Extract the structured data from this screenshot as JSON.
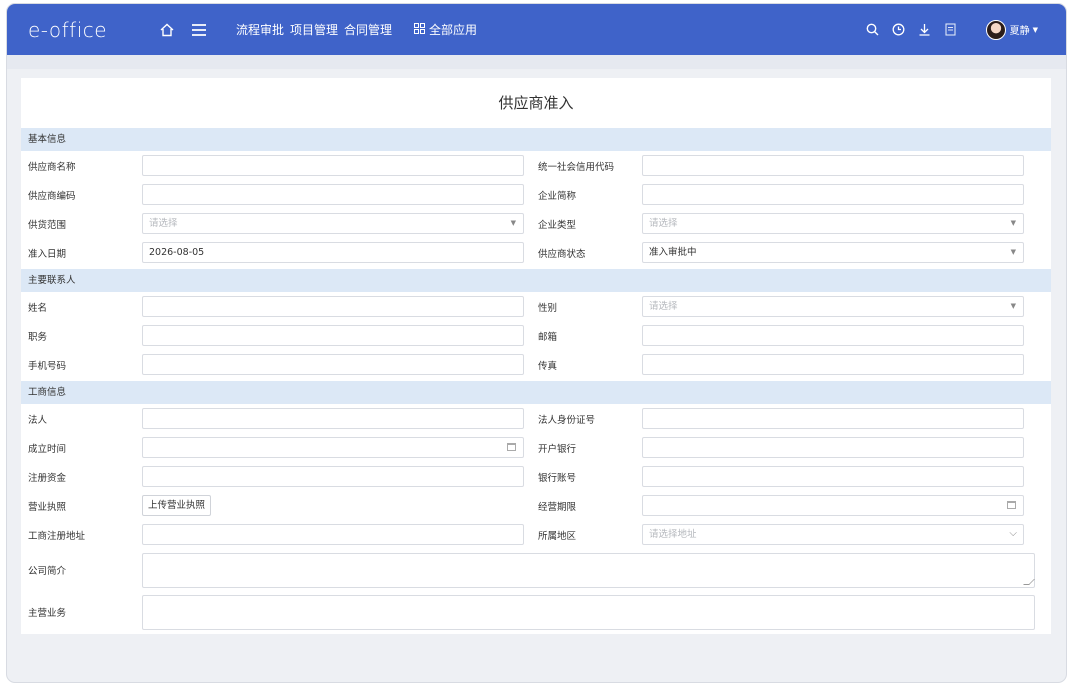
{
  "app": {
    "logo": "e-office"
  },
  "nav": {
    "links": [
      "流程审批",
      "项目管理",
      "合同管理"
    ],
    "all_apps": "全部应用"
  },
  "user": {
    "name": "夏静"
  },
  "form": {
    "title": "供应商准入",
    "sections": {
      "basic": "基本信息",
      "contact": "主要联系人",
      "business": "工商信息"
    },
    "fields": {
      "supplier_name": {
        "label": "供应商名称",
        "value": ""
      },
      "credit_code": {
        "label": "统一社会信用代码",
        "value": ""
      },
      "supplier_code": {
        "label": "供应商编码",
        "value": ""
      },
      "short_name": {
        "label": "企业简称",
        "value": ""
      },
      "supply_scope": {
        "label": "供货范围",
        "placeholder": "请选择"
      },
      "enterprise_type": {
        "label": "企业类型",
        "placeholder": "请选择"
      },
      "admit_date": {
        "label": "准入日期",
        "value": "2026-08-05"
      },
      "supplier_status": {
        "label": "供应商状态",
        "value": "准入审批中"
      },
      "name": {
        "label": "姓名",
        "value": ""
      },
      "gender": {
        "label": "性别",
        "placeholder": "请选择"
      },
      "position": {
        "label": "职务",
        "value": ""
      },
      "email": {
        "label": "邮箱",
        "value": ""
      },
      "mobile": {
        "label": "手机号码",
        "value": ""
      },
      "fax": {
        "label": "传真",
        "value": ""
      },
      "legal_person": {
        "label": "法人",
        "value": ""
      },
      "legal_id": {
        "label": "法人身份证号",
        "value": ""
      },
      "founded": {
        "label": "成立时间",
        "value": ""
      },
      "bank": {
        "label": "开户银行",
        "value": ""
      },
      "capital": {
        "label": "注册资金",
        "value": ""
      },
      "account": {
        "label": "银行账号",
        "value": ""
      },
      "license": {
        "label": "营业执照",
        "button": "上传营业执照"
      },
      "business_term": {
        "label": "经营期限",
        "value": ""
      },
      "reg_address": {
        "label": "工商注册地址",
        "value": ""
      },
      "region": {
        "label": "所属地区",
        "placeholder": "请选择地址"
      },
      "intro": {
        "label": "公司简介",
        "value": ""
      },
      "main_business": {
        "label": "主营业务",
        "value": ""
      }
    }
  }
}
